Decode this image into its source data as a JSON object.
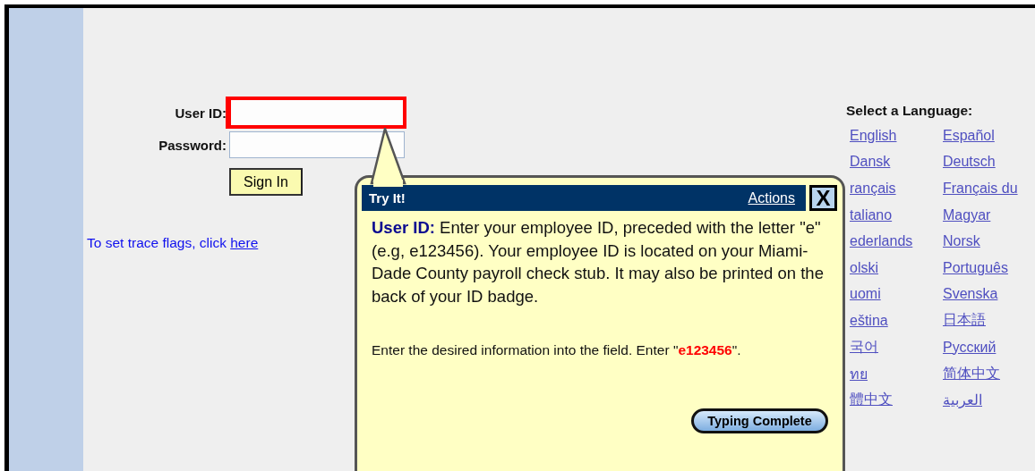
{
  "login": {
    "fields": [
      {
        "label": "User ID:",
        "highlighted": true,
        "caret": true
      },
      {
        "label": "Password:",
        "highlighted": false,
        "caret": false
      }
    ],
    "button": "Sign In",
    "trace": {
      "text": "To set trace flags, click",
      "link": "here"
    }
  },
  "languages": {
    "heading": "Select a Language:",
    "items": [
      "English",
      "Español",
      "Dansk",
      "Deutsch",
      "rançais",
      "Français du",
      "taliano",
      "Magyar",
      "ederlands",
      "Norsk",
      "olski",
      "Português",
      "uomi",
      "Svenska",
      "eština",
      "日本語",
      "국어",
      "Русский",
      "ทย",
      "简体中文",
      "體中文",
      "العربية"
    ]
  },
  "callout": {
    "title": "Try It!",
    "actions": "Actions",
    "close": "X",
    "intro": "**User ID:** Enter your employee ID, preceded with the letter \"e\" (e.g, e123456). Your employee ID is located on your Miami-Dade County payroll check stub. It may also be printed on the back of your ID badge.",
    "instruction": "Enter the desired information into the field. Enter \"**e123456**\".",
    "button": "Typing Complete"
  }
}
